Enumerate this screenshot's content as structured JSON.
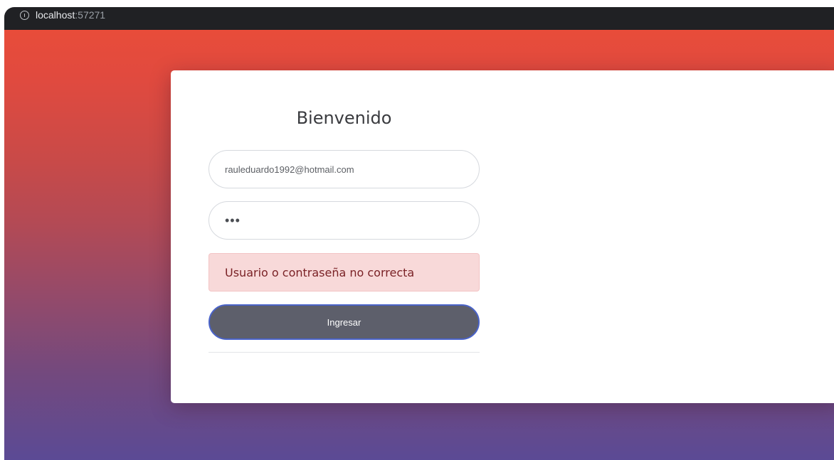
{
  "browser": {
    "host": "localhost",
    "port": ":57271"
  },
  "login": {
    "title": "Bienvenido",
    "email_value": "rauleduardo1992@hotmail.com",
    "password_value": "•••",
    "error_message": "Usuario o contraseña no correcta",
    "submit_label": "Ingresar"
  },
  "colors": {
    "gradient_top": "#e84c3a",
    "gradient_bottom": "#5b4a95",
    "button_bg": "#5d5f6b",
    "button_border": "#4a63c9",
    "alert_bg": "#f8d9d9",
    "alert_text": "#7a2226"
  },
  "icons": {
    "address_info": "info-icon"
  }
}
